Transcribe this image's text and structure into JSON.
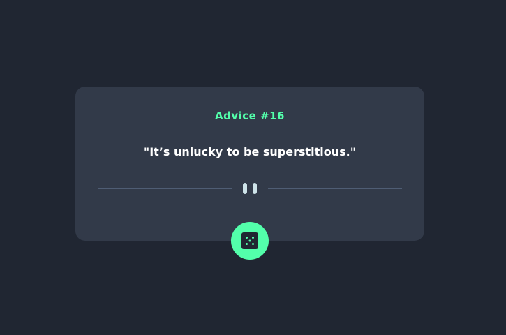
{
  "advice": {
    "number_label": "Advice #16",
    "quote": "\"It’s unlucky to be superstitious.\""
  },
  "icons": {
    "divider": "pause-icon",
    "button": "dice-icon"
  },
  "colors": {
    "background": "#202632",
    "card": "#323a49",
    "accent": "#53ffab",
    "text": "#ffffff",
    "divider_line": "#4f5d74",
    "pause_bars": "#cee3e9"
  }
}
